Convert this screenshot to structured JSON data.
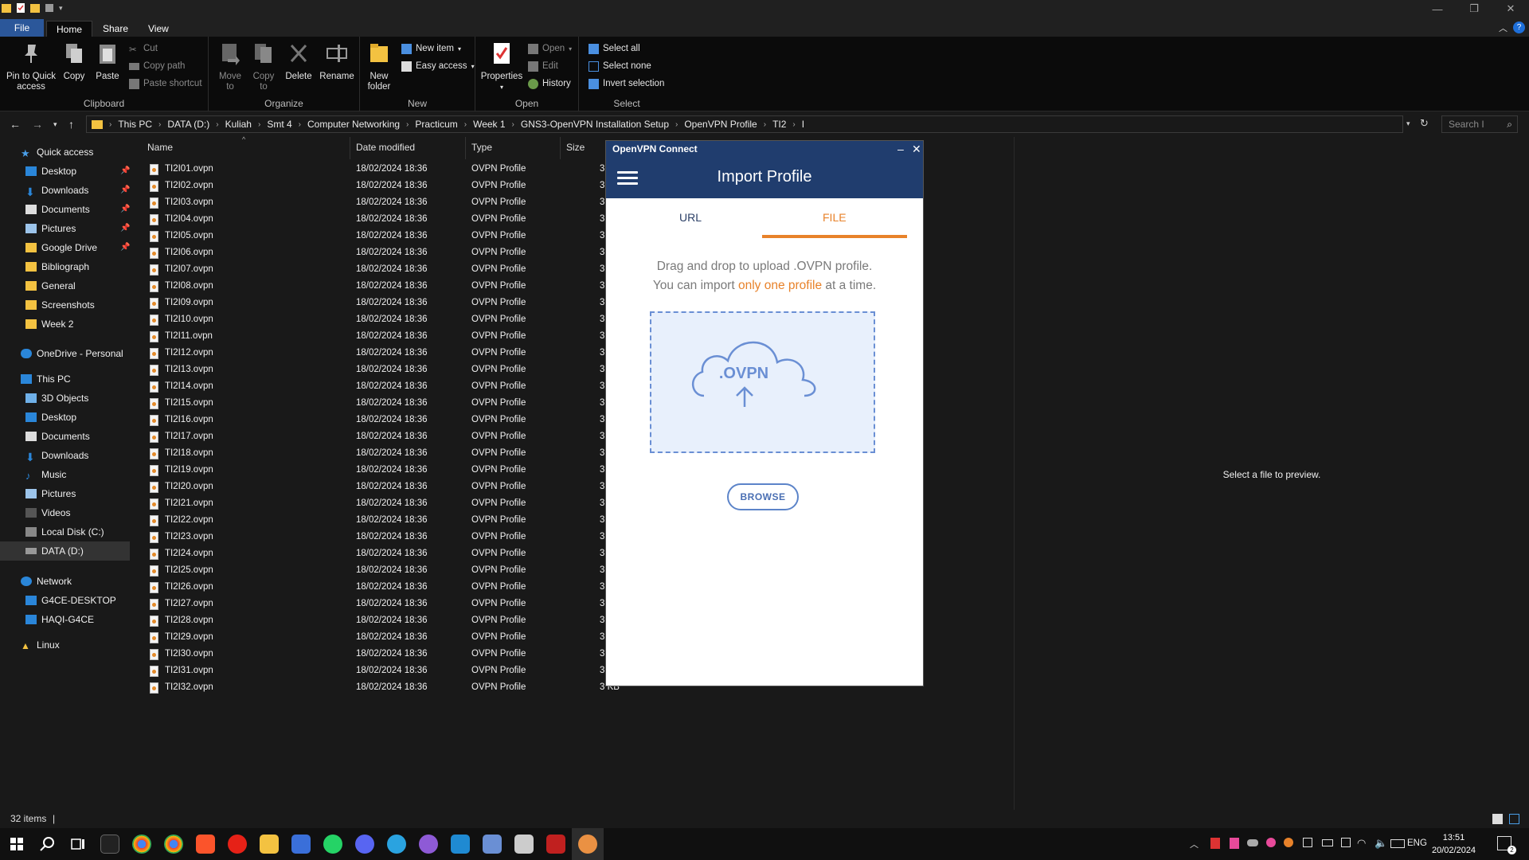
{
  "window": {
    "min": "—",
    "max": "❐",
    "close": "✕"
  },
  "ribbon_tabs": [
    "File",
    "Home",
    "Share",
    "View"
  ],
  "clipboard": {
    "pin": [
      "Pin to Quick",
      "access"
    ],
    "copy": "Copy",
    "paste": "Paste",
    "cut": "Cut",
    "copy_path": "Copy path",
    "paste_shortcut": "Paste shortcut",
    "label": "Clipboard"
  },
  "organize": {
    "move": [
      "Move",
      "to"
    ],
    "copy": [
      "Copy",
      "to"
    ],
    "delete": "Delete",
    "rename": "Rename",
    "label": "Organize"
  },
  "new": {
    "folder": [
      "New",
      "folder"
    ],
    "item": "New item",
    "easy": "Easy access",
    "label": "New"
  },
  "open": {
    "properties": "Properties",
    "open": "Open",
    "edit": "Edit",
    "history": "History",
    "label": "Open"
  },
  "select": {
    "all": "Select all",
    "none": "Select none",
    "invert": "Invert selection",
    "label": "Select"
  },
  "breadcrumb": [
    "This PC",
    "DATA (D:)",
    "Kuliah",
    "Smt 4",
    "Computer Networking",
    "Practicum",
    "Week 1",
    "GNS3-OpenVPN Installation Setup",
    "OpenVPN Profile",
    "TI2",
    "I"
  ],
  "search_placeholder": "Search I",
  "nav": {
    "quick_access": "Quick access",
    "quick_items": [
      "Desktop",
      "Downloads",
      "Documents",
      "Pictures",
      "Google Drive",
      "Bibliograph",
      "General",
      "Screenshots",
      "Week 2"
    ],
    "onedrive": "OneDrive - Personal",
    "this_pc": "This PC",
    "pc_items": [
      "3D Objects",
      "Desktop",
      "Documents",
      "Downloads",
      "Music",
      "Pictures",
      "Videos",
      "Local Disk (C:)",
      "DATA (D:)"
    ],
    "network": "Network",
    "net_items": [
      "G4CE-DESKTOP",
      "HAQI-G4CE"
    ],
    "linux": "Linux"
  },
  "columns": {
    "name": "Name",
    "date": "Date modified",
    "type": "Type",
    "size": "Size"
  },
  "files": [
    {
      "name": "TI2I01.ovpn",
      "date": "18/02/2024 18:36",
      "type": "OVPN Profile",
      "size": "3"
    },
    {
      "name": "TI2I02.ovpn",
      "date": "18/02/2024 18:36",
      "type": "OVPN Profile",
      "size": "3"
    },
    {
      "name": "TI2I03.ovpn",
      "date": "18/02/2024 18:36",
      "type": "OVPN Profile",
      "size": "3"
    },
    {
      "name": "TI2I04.ovpn",
      "date": "18/02/2024 18:36",
      "type": "OVPN Profile",
      "size": "3"
    },
    {
      "name": "TI2I05.ovpn",
      "date": "18/02/2024 18:36",
      "type": "OVPN Profile",
      "size": "3"
    },
    {
      "name": "TI2I06.ovpn",
      "date": "18/02/2024 18:36",
      "type": "OVPN Profile",
      "size": "3"
    },
    {
      "name": "TI2I07.ovpn",
      "date": "18/02/2024 18:36",
      "type": "OVPN Profile",
      "size": "3"
    },
    {
      "name": "TI2I08.ovpn",
      "date": "18/02/2024 18:36",
      "type": "OVPN Profile",
      "size": "3"
    },
    {
      "name": "TI2I09.ovpn",
      "date": "18/02/2024 18:36",
      "type": "OVPN Profile",
      "size": "3"
    },
    {
      "name": "TI2I10.ovpn",
      "date": "18/02/2024 18:36",
      "type": "OVPN Profile",
      "size": "3"
    },
    {
      "name": "TI2I11.ovpn",
      "date": "18/02/2024 18:36",
      "type": "OVPN Profile",
      "size": "3"
    },
    {
      "name": "TI2I12.ovpn",
      "date": "18/02/2024 18:36",
      "type": "OVPN Profile",
      "size": "3"
    },
    {
      "name": "TI2I13.ovpn",
      "date": "18/02/2024 18:36",
      "type": "OVPN Profile",
      "size": "3"
    },
    {
      "name": "TI2I14.ovpn",
      "date": "18/02/2024 18:36",
      "type": "OVPN Profile",
      "size": "3"
    },
    {
      "name": "TI2I15.ovpn",
      "date": "18/02/2024 18:36",
      "type": "OVPN Profile",
      "size": "3"
    },
    {
      "name": "TI2I16.ovpn",
      "date": "18/02/2024 18:36",
      "type": "OVPN Profile",
      "size": "3"
    },
    {
      "name": "TI2I17.ovpn",
      "date": "18/02/2024 18:36",
      "type": "OVPN Profile",
      "size": "3"
    },
    {
      "name": "TI2I18.ovpn",
      "date": "18/02/2024 18:36",
      "type": "OVPN Profile",
      "size": "3"
    },
    {
      "name": "TI2I19.ovpn",
      "date": "18/02/2024 18:36",
      "type": "OVPN Profile",
      "size": "3"
    },
    {
      "name": "TI2I20.ovpn",
      "date": "18/02/2024 18:36",
      "type": "OVPN Profile",
      "size": "3"
    },
    {
      "name": "TI2I21.ovpn",
      "date": "18/02/2024 18:36",
      "type": "OVPN Profile",
      "size": "3"
    },
    {
      "name": "TI2I22.ovpn",
      "date": "18/02/2024 18:36",
      "type": "OVPN Profile",
      "size": "3"
    },
    {
      "name": "TI2I23.ovpn",
      "date": "18/02/2024 18:36",
      "type": "OVPN Profile",
      "size": "3"
    },
    {
      "name": "TI2I24.ovpn",
      "date": "18/02/2024 18:36",
      "type": "OVPN Profile",
      "size": "3"
    },
    {
      "name": "TI2I25.ovpn",
      "date": "18/02/2024 18:36",
      "type": "OVPN Profile",
      "size": "3"
    },
    {
      "name": "TI2I26.ovpn",
      "date": "18/02/2024 18:36",
      "type": "OVPN Profile",
      "size": "3"
    },
    {
      "name": "TI2I27.ovpn",
      "date": "18/02/2024 18:36",
      "type": "OVPN Profile",
      "size": "3"
    },
    {
      "name": "TI2I28.ovpn",
      "date": "18/02/2024 18:36",
      "type": "OVPN Profile",
      "size": "3"
    },
    {
      "name": "TI2I29.ovpn",
      "date": "18/02/2024 18:36",
      "type": "OVPN Profile",
      "size": "3"
    },
    {
      "name": "TI2I30.ovpn",
      "date": "18/02/2024 18:36",
      "type": "OVPN Profile",
      "size": "3"
    },
    {
      "name": "TI2I31.ovpn",
      "date": "18/02/2024 18:36",
      "type": "OVPN Profile",
      "size": "3"
    },
    {
      "name": "TI2I32.ovpn",
      "date": "18/02/2024 18:36",
      "type": "OVPN Profile",
      "size": "3 KB"
    }
  ],
  "preview_text": "Select a file to preview.",
  "status_text": "32 items",
  "ovpn": {
    "title": "OpenVPN Connect",
    "header": "Import Profile",
    "tab_url": "URL",
    "tab_file": "FILE",
    "msg_line1": "Drag and drop to upload .OVPN profile.",
    "msg_pre": "You can import ",
    "msg_hl": "only one profile",
    "msg_post": " at a time.",
    "drop_label": ".OVPN",
    "browse": "BROWSE"
  },
  "tray": {
    "lang": "ENG",
    "time": "13:51",
    "date": "20/02/2024",
    "notif": "2"
  },
  "colors": {
    "accent_orange": "#e8822a",
    "ovpn_blue": "#203d6e",
    "file_tab": "#2b579a"
  }
}
